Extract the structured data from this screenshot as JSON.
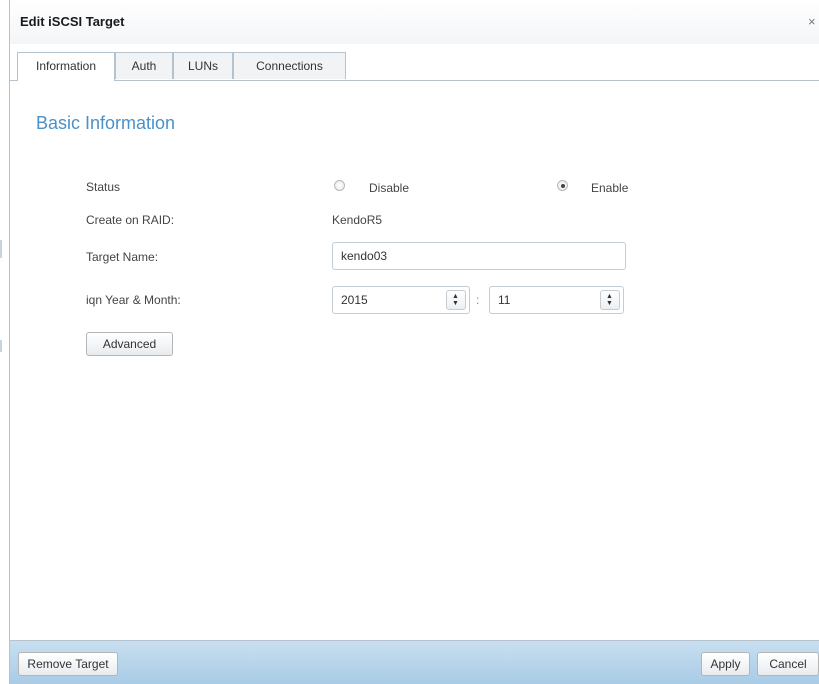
{
  "dialog": {
    "title": "Edit iSCSI Target",
    "close_glyph": "×"
  },
  "tabs": [
    {
      "label": "Information",
      "active": true
    },
    {
      "label": "Auth",
      "active": false
    },
    {
      "label": "LUNs",
      "active": false
    },
    {
      "label": "Connections",
      "active": false
    }
  ],
  "section": {
    "title": "Basic Information"
  },
  "form": {
    "status": {
      "label": "Status",
      "options": [
        {
          "label": "Disable",
          "selected": false
        },
        {
          "label": "Enable",
          "selected": true
        }
      ]
    },
    "raid": {
      "label": "Create on RAID:",
      "value": "KendoR5"
    },
    "target_name": {
      "label": "Target Name:",
      "value": "kendo03"
    },
    "iqn": {
      "label": "iqn Year & Month:",
      "year": "2015",
      "separator": ":",
      "month": "11"
    },
    "advanced_button": "Advanced"
  },
  "footer": {
    "remove_button": "Remove Target",
    "apply_button": "Apply",
    "cancel_button": "Cancel"
  },
  "icons": {
    "spin_up": "▲",
    "spin_down": "▼"
  },
  "colors": {
    "accent": "#4a90c9",
    "footer_gradient_top": "#c8dff0",
    "footer_gradient_bottom": "#a9cbe6"
  }
}
